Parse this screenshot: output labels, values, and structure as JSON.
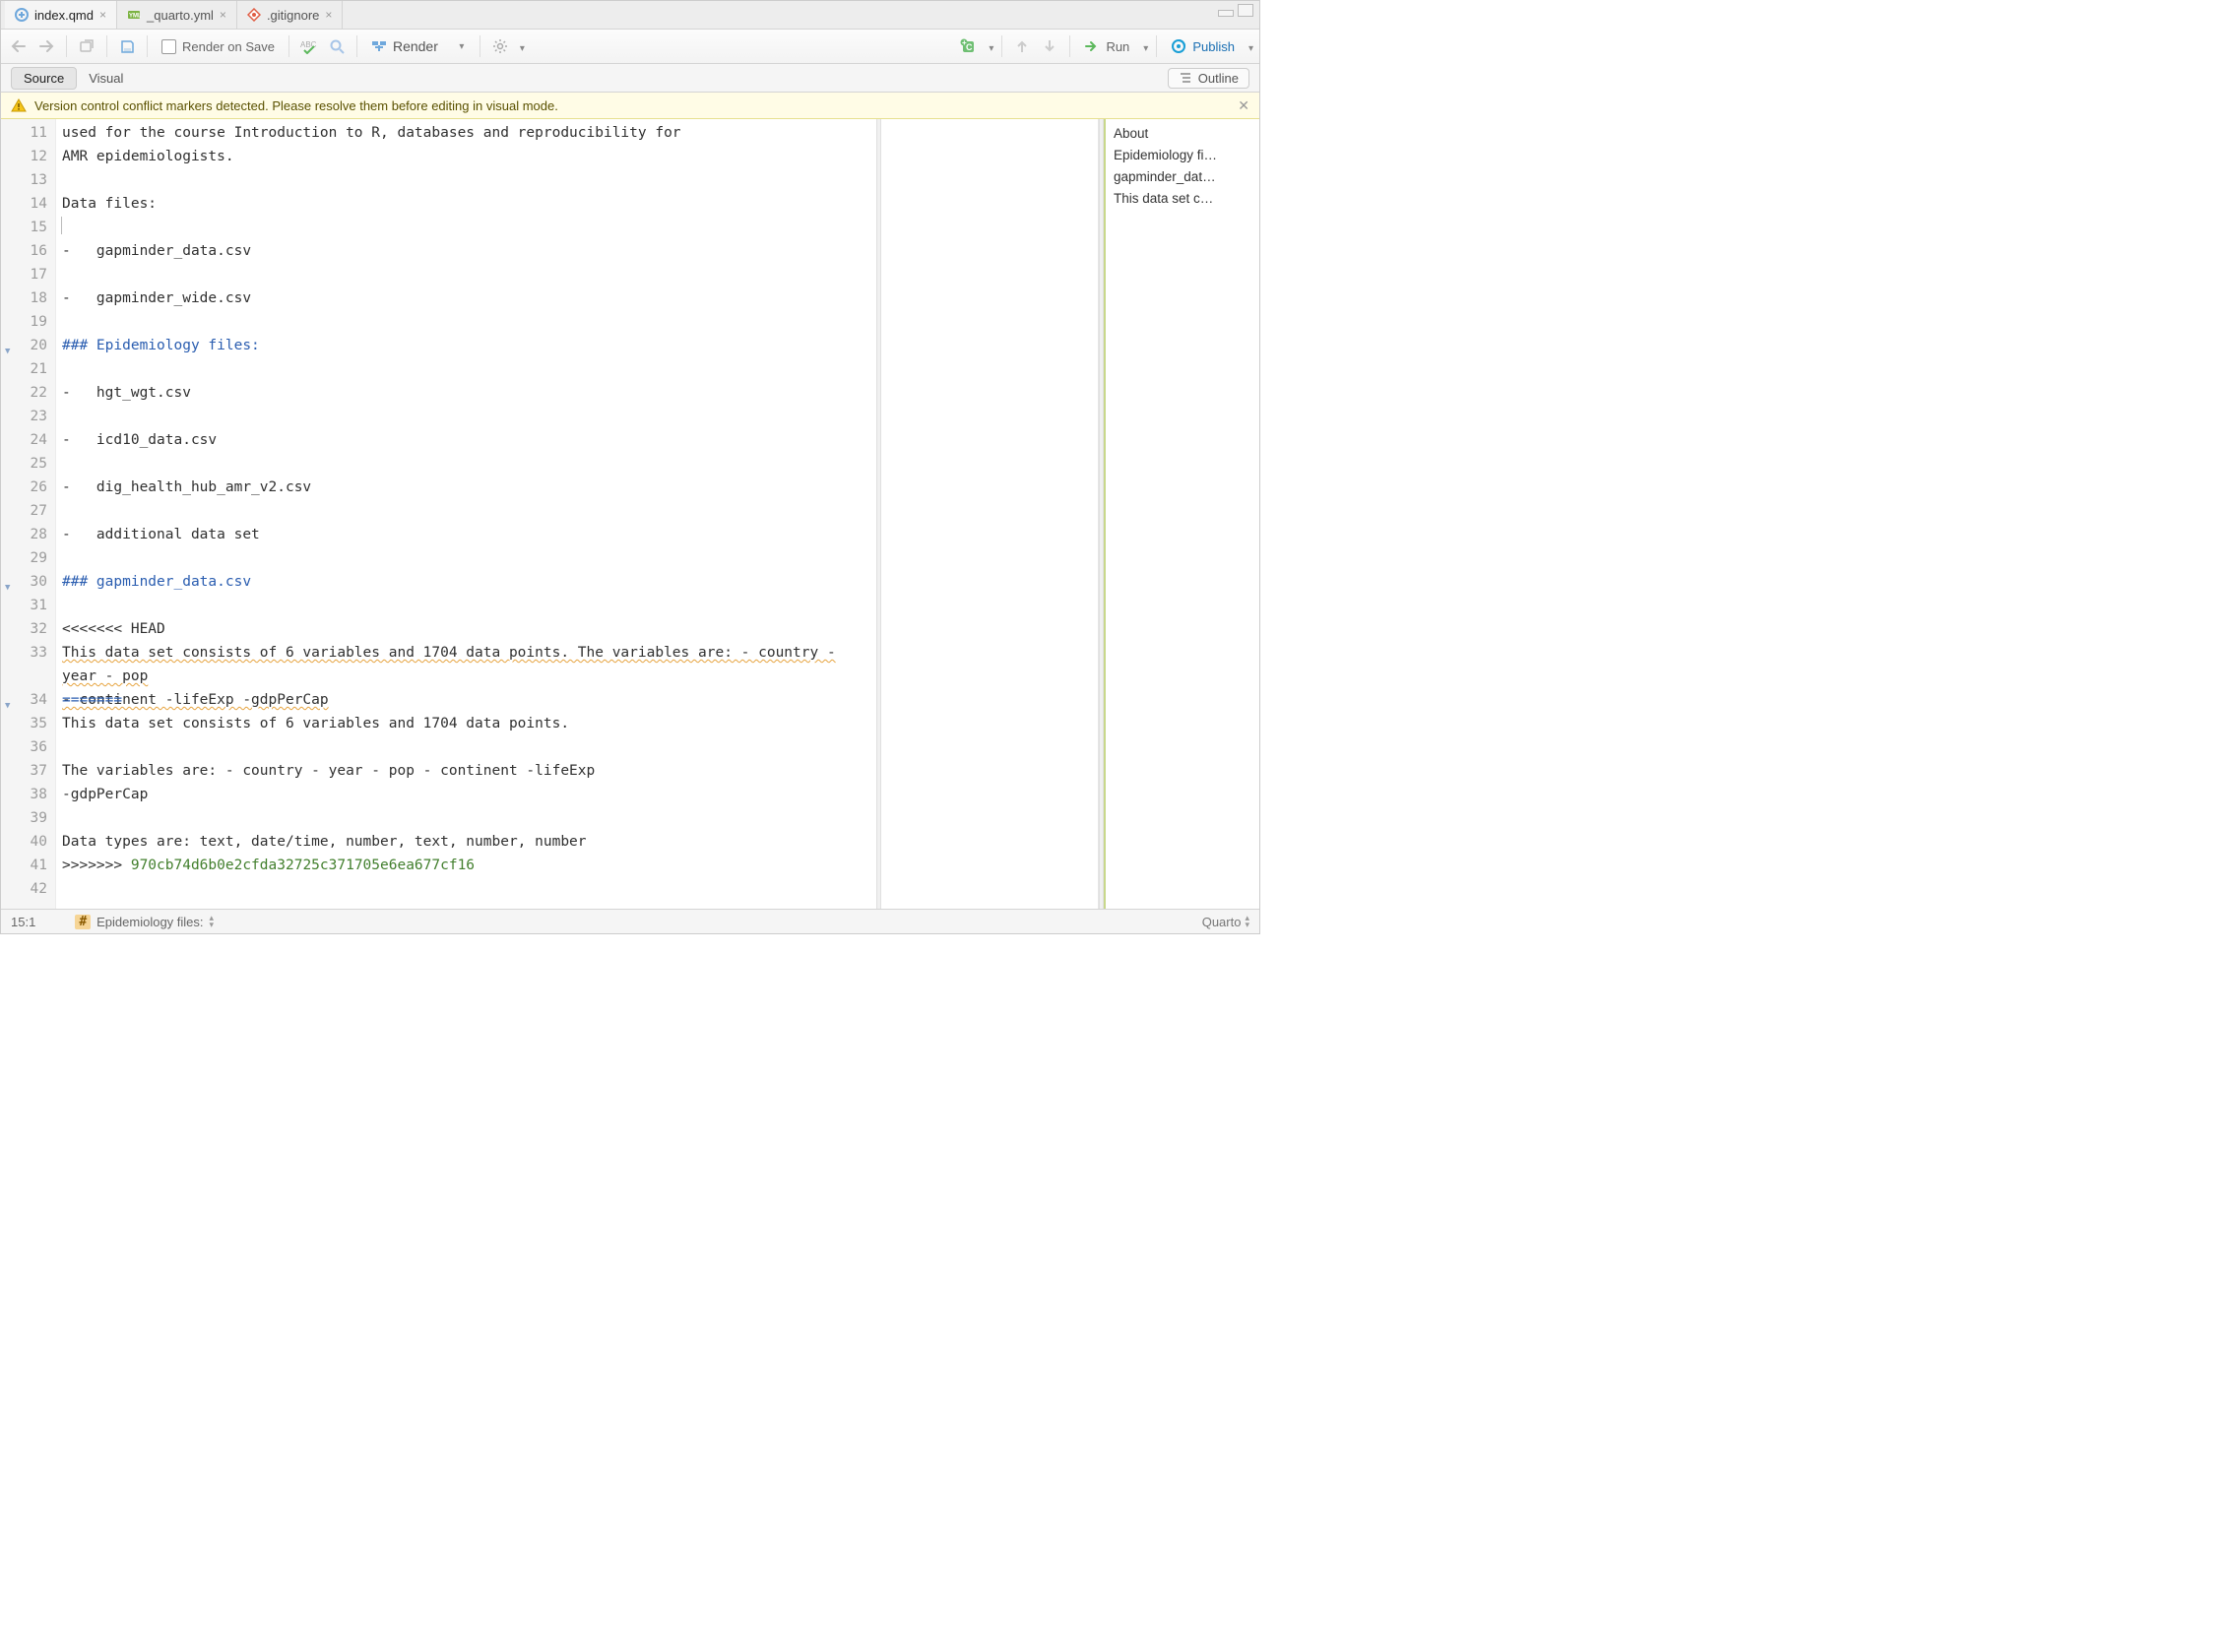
{
  "tabs": [
    {
      "label": "index.qmd",
      "active": true
    },
    {
      "label": "_quarto.yml",
      "active": false
    },
    {
      "label": ".gitignore",
      "active": false
    }
  ],
  "toolbar": {
    "render_on_save": "Render on Save",
    "render": "Render",
    "run": "Run",
    "publish": "Publish"
  },
  "view": {
    "source": "Source",
    "visual": "Visual",
    "outline_btn": "Outline"
  },
  "warning": "Version control conflict markers detected. Please resolve them before editing in visual mode.",
  "gutter_start": 11,
  "gutter_end": 42,
  "fold_lines": [
    20,
    30,
    34
  ],
  "code_lines": [
    {
      "n": 11,
      "text": "used for the course Introduction to R, databases and reproducibility for "
    },
    {
      "n": 12,
      "text": "AMR epidemiologists."
    },
    {
      "n": 13,
      "text": ""
    },
    {
      "n": 14,
      "text": "Data files:"
    },
    {
      "n": 15,
      "text": "",
      "cursor": true
    },
    {
      "n": 16,
      "text": "-   gapminder_data.csv"
    },
    {
      "n": 17,
      "text": ""
    },
    {
      "n": 18,
      "text": "-   gapminder_wide.csv"
    },
    {
      "n": 19,
      "text": ""
    },
    {
      "n": 20,
      "text": "### Epidemiology files:",
      "cls": "h3"
    },
    {
      "n": 21,
      "text": ""
    },
    {
      "n": 22,
      "text": "-   hgt_wgt.csv"
    },
    {
      "n": 23,
      "text": ""
    },
    {
      "n": 24,
      "text": "-   icd10_data.csv"
    },
    {
      "n": 25,
      "text": ""
    },
    {
      "n": 26,
      "text": "-   dig_health_hub_amr_v2.csv"
    },
    {
      "n": 27,
      "text": ""
    },
    {
      "n": 28,
      "text": "-   additional data set"
    },
    {
      "n": 29,
      "text": ""
    },
    {
      "n": 30,
      "text": "### gapminder_data.csv",
      "cls": "h3"
    },
    {
      "n": 31,
      "text": ""
    },
    {
      "n": 32,
      "text": "<<<<<<< HEAD"
    },
    {
      "n": 33,
      "wavy_segments": [
        "This data set consists of 6 variables and 1704 data points. The variables are: - country - year - pop ",
        "- continent -lifeExp -gdpPerCap"
      ],
      "height": 2
    },
    {
      "n": 34,
      "text": "=======",
      "cls": "h3"
    },
    {
      "n": 35,
      "text": "This data set consists of 6 variables and 1704 data points."
    },
    {
      "n": 36,
      "text": ""
    },
    {
      "n": 37,
      "text": "The variables are: - country - year - pop - continent -lifeExp "
    },
    {
      "n": 38,
      "text": "-gdpPerCap"
    },
    {
      "n": 39,
      "text": ""
    },
    {
      "n": 40,
      "text": "Data types are: text, date/time, number, text, number, number"
    },
    {
      "n": 41,
      "prefix": ">>>>>>> ",
      "hash": "970cb74d6b0e2cfda32725c371705e6ea677cf16"
    },
    {
      "n": 42,
      "text": ""
    }
  ],
  "outline": {
    "items": [
      "About",
      "Epidemiology fi…",
      "gapminder_dat…",
      "This data set c…"
    ]
  },
  "status": {
    "pos": "15:1",
    "breadcrumb": "Epidemiology files:",
    "lang": "Quarto"
  }
}
